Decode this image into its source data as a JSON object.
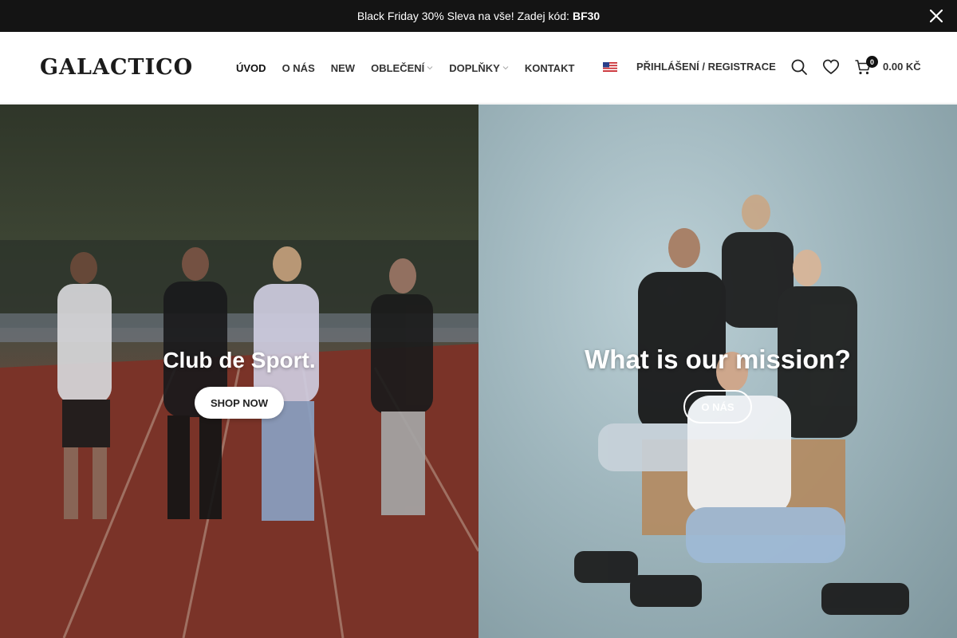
{
  "promo": {
    "text": "Black Friday 30% Sleva na vše! Zadej kód:",
    "code": "BF30",
    "close_icon": "close-icon"
  },
  "header": {
    "logo": "GALACTICO",
    "nav": [
      {
        "label": "ÚVOD",
        "active": true
      },
      {
        "label": "O NÁS"
      },
      {
        "label": "NEW"
      },
      {
        "label": "OBLEČENÍ",
        "dropdown": true
      },
      {
        "label": "DOPLŇKY",
        "dropdown": true
      },
      {
        "label": "KONTAKT"
      }
    ],
    "language_icon": "us-flag-icon",
    "login_label": "PŘIHLÁŠENÍ / REGISTRACE",
    "cart": {
      "count": "0",
      "total": "0.00 KČ"
    }
  },
  "hero_left": {
    "title": "Club de Sport.",
    "button_label": "SHOP NOW"
  },
  "hero_right": {
    "title": "What is our mission?",
    "button_label": "O NÁS"
  },
  "colors": {
    "promo_bg": "#141414",
    "text": "#242424",
    "white": "#ffffff"
  }
}
